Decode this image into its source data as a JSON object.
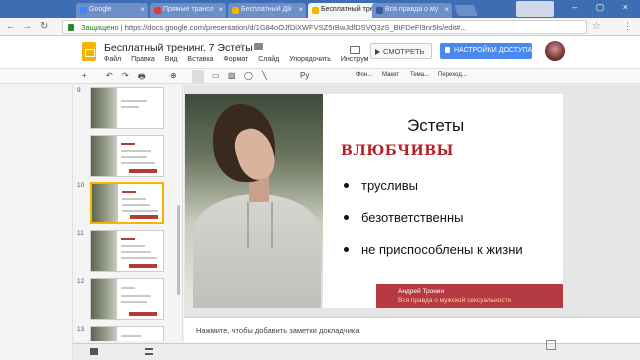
{
  "browser": {
    "tabs": [
      {
        "label": "Google",
        "favicon_color": "#4285f4",
        "active": false
      },
      {
        "label": "Прямые трансл",
        "favicon_color": "#e53935",
        "active": false
      },
      {
        "label": "Бесплатный Дй",
        "favicon_color": "#f4b400",
        "active": false
      },
      {
        "label": "Бесплатный трен",
        "favicon_color": "#f4b400",
        "active": true
      },
      {
        "label": "Вся правда о му",
        "favicon_color": "#3b5998",
        "active": false
      }
    ],
    "address": {
      "secure_label": "Защищено",
      "separator": " | ",
      "url": "https://docs.google.com/presentation/d/1G84oOJfDiXWFVSZ5rBwJdfDSVQ3zS_BtFDeFI9nr5ls/edit#..."
    }
  },
  "docs": {
    "title": "Бесплатный тренинг. 7 Эстеты",
    "menu": [
      "Файл",
      "Правка",
      "Вид",
      "Вставка",
      "Формат",
      "Слайд",
      "Упорядочить",
      "Инструм"
    ],
    "present_label": "СМОТРЕТЬ",
    "share_label": "НАСТРОЙКИ ДОСТУПА"
  },
  "toolbar": {
    "items": [
      "+",
      "↶",
      "↷",
      "🖶",
      "⊕"
    ],
    "zoom_icon": "zoom-icon",
    "text_tool": "Ру",
    "labels": [
      "Фон...",
      "Макет",
      "Тема...",
      "Переход..."
    ]
  },
  "filmstrip": {
    "slides": [
      {
        "num": "9",
        "title": "Определение\nЭСТЕТЫ",
        "selected": false
      },
      {
        "num": "",
        "title": "",
        "selected": false
      },
      {
        "num": "10",
        "title": "",
        "selected": true
      },
      {
        "num": "11",
        "title": "",
        "selected": false
      },
      {
        "num": "12",
        "title": "",
        "selected": false
      },
      {
        "num": "13",
        "title": "",
        "selected": false
      }
    ]
  },
  "slide": {
    "title": "Эстеты",
    "subtitle": "ВЛЮБЧИВЫ",
    "bullets": [
      "трусливы",
      "безответственны",
      "не приспособлены к жизни"
    ],
    "author": "Андрей Тронин",
    "tagline": "Вся правда о мужской сексуальности"
  },
  "notes": {
    "placeholder": "Нажмите, чтобы добавить заметки докладчика"
  },
  "colors": {
    "accent_red": "#b52025",
    "share_blue": "#4a88f0",
    "slides_yellow": "#f4b400"
  }
}
